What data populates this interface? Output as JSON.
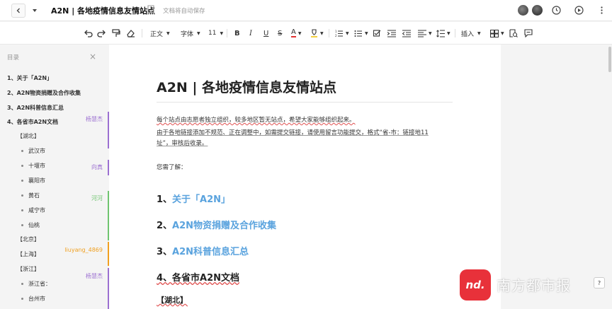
{
  "header": {
    "title": "A2N | 各地疫情信息友情站点",
    "autosave": "文档将自动保存"
  },
  "toolbar": {
    "style": "正文",
    "font": "字体",
    "size": "11",
    "insert": "插入"
  },
  "sidebar": {
    "heading": "目录",
    "items": [
      {
        "label": "1、关于「A2N」",
        "level": 1
      },
      {
        "label": "2、A2N物资捐赠及合作收集",
        "level": 1
      },
      {
        "label": "3、A2N科普信息汇总",
        "level": 1
      },
      {
        "label": "4、各省市A2N文档",
        "level": 1
      },
      {
        "label": "【湖北】",
        "level": 2
      },
      {
        "label": "武汉市",
        "level": 3
      },
      {
        "label": "十堰市",
        "level": 3
      },
      {
        "label": "襄阳市",
        "level": 3
      },
      {
        "label": "黄石",
        "level": 3
      },
      {
        "label": "咸宁市",
        "level": 3
      },
      {
        "label": "仙桃",
        "level": 3
      },
      {
        "label": "【北京】",
        "level": 2
      },
      {
        "label": "【上海】",
        "level": 2
      },
      {
        "label": "【浙江】",
        "level": 2
      },
      {
        "label": "浙江省：",
        "level": 3
      },
      {
        "label": "台州市",
        "level": 3
      }
    ]
  },
  "collaborators": [
    {
      "name": "杨慧杰",
      "color": "#9b6fd1"
    },
    {
      "name": "向真",
      "color": "#9b6fd1"
    },
    {
      "name": "河河",
      "color": "#6fc46f"
    },
    {
      "name": "liuyang_4869",
      "color": "#f0a020"
    },
    {
      "name": "杨慧杰",
      "color": "#9b6fd1"
    }
  ],
  "document": {
    "title": "A2N | 各地疫情信息友情站点",
    "para1": "每个站点由志愿者独立组织，较多地区暂无站点，希望大家能够组织起来。",
    "para2a": "由于各地链接添加不规范、正在调整中，如需提交链接，请使用留言功能提交，格式“省-市：链接地11",
    "para2b": "址”，审核后收录。",
    "para3": "您需了解：",
    "h1_num": "1、",
    "h1_link": "关于「A2N」",
    "h2_num": "2、",
    "h2_link": "A2N物资捐赠及合作收集",
    "h3_num": "3、",
    "h3_link": "A2N科普信息汇总",
    "h4": "4、各省市A2N文档",
    "h5": "【湖北】"
  },
  "watermark": {
    "logo": "nd.",
    "text": "南方都市报"
  },
  "corner_button": "?"
}
